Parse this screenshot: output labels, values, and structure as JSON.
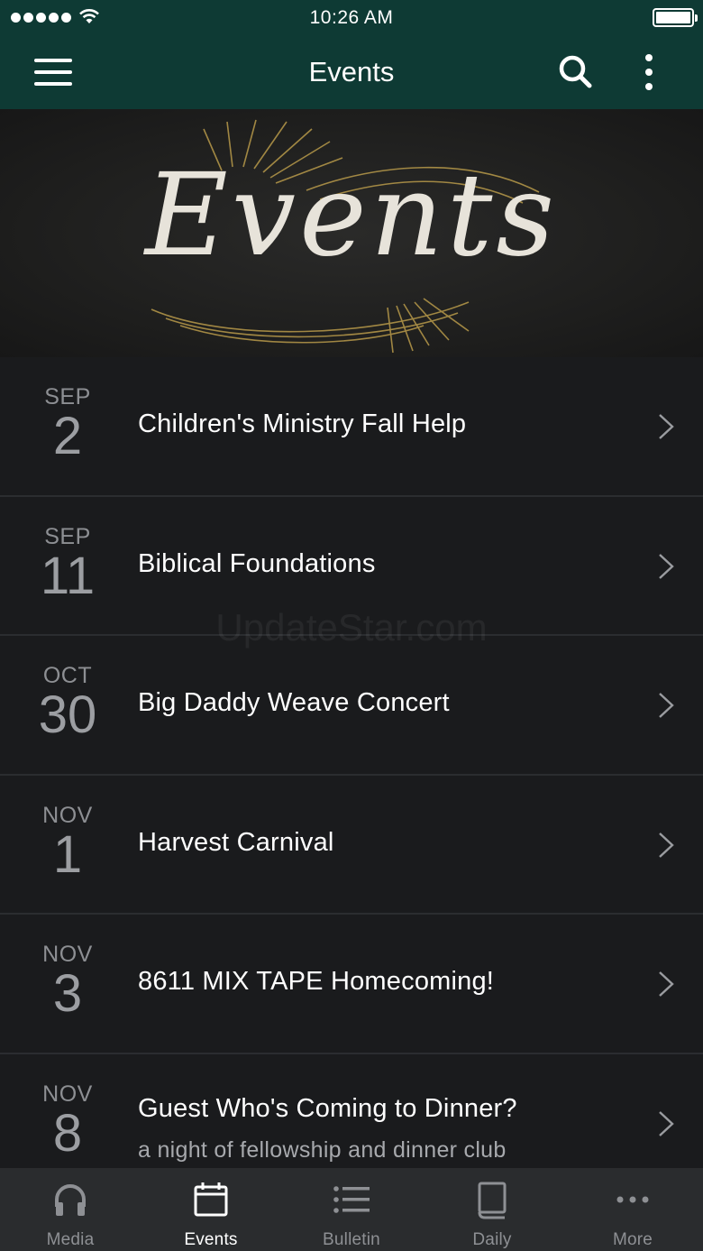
{
  "status_bar": {
    "time": "10:26 AM"
  },
  "nav": {
    "title": "Events",
    "menu_icon": "hamburger-icon",
    "search_icon": "search-icon",
    "more_icon": "vertical-ellipsis-icon"
  },
  "hero": {
    "title": "Events"
  },
  "events": [
    {
      "month": "SEP",
      "day": "2",
      "title": "Children's Ministry Fall Help",
      "subtitle": ""
    },
    {
      "month": "SEP",
      "day": "11",
      "title": "Biblical Foundations",
      "subtitle": ""
    },
    {
      "month": "OCT",
      "day": "30",
      "title": "Big Daddy Weave Concert",
      "subtitle": ""
    },
    {
      "month": "NOV",
      "day": "1",
      "title": "Harvest Carnival",
      "subtitle": ""
    },
    {
      "month": "NOV",
      "day": "3",
      "title": "8611 MIX TAPE Homecoming!",
      "subtitle": ""
    },
    {
      "month": "NOV",
      "day": "8",
      "title": "Guest Who's Coming to Dinner?",
      "subtitle": "a night of fellowship and dinner club"
    }
  ],
  "watermark": "UpdateStar.com",
  "tabs": [
    {
      "label": "Media",
      "icon": "headphones-icon",
      "active": false
    },
    {
      "label": "Events",
      "icon": "calendar-icon",
      "active": true
    },
    {
      "label": "Bulletin",
      "icon": "list-icon",
      "active": false
    },
    {
      "label": "Daily",
      "icon": "book-icon",
      "active": false
    },
    {
      "label": "More",
      "icon": "ellipsis-icon",
      "active": false
    }
  ],
  "colors": {
    "nav_bg": "#0e3a34",
    "list_bg": "#1a1b1d",
    "tabbar_bg": "#2a2c2e",
    "accent_gold": "#b89a4a"
  }
}
